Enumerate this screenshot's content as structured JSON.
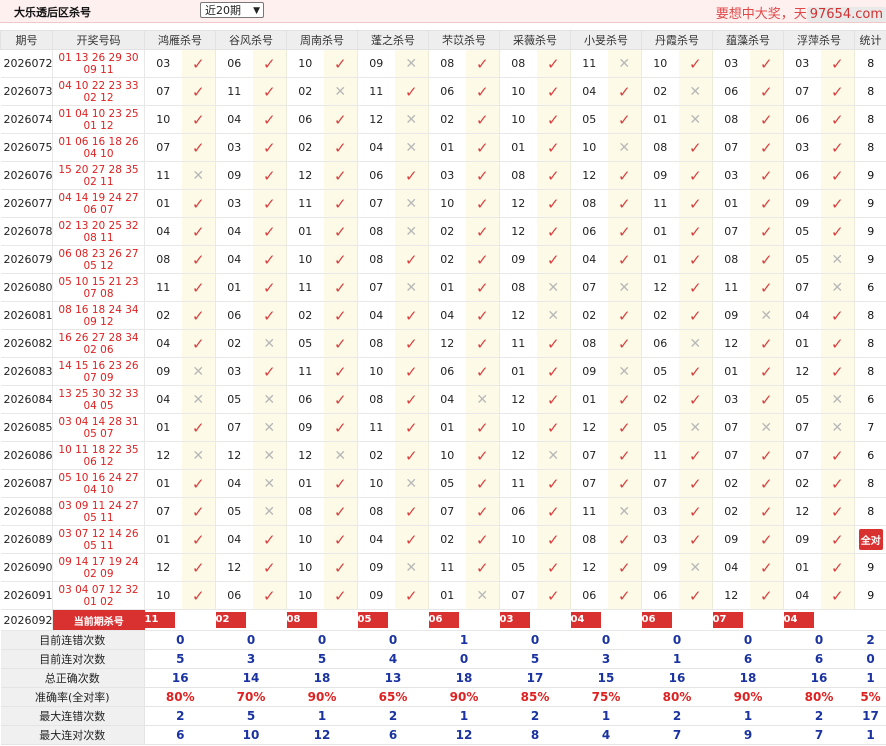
{
  "header": {
    "title": "大乐透后区杀号",
    "period_select": "近20期",
    "slogan": "要想中大奖，天",
    "site": "97654.com"
  },
  "columns": {
    "issue": "期号",
    "draw": "开奖号码",
    "experts": [
      "鸿雁杀号",
      "谷风杀号",
      "周南杀号",
      "蓬之杀号",
      "芣苡杀号",
      "采薇杀号",
      "小旻杀号",
      "丹霞杀号",
      "蕴藻杀号",
      "浮萍杀号"
    ],
    "stat": "统计"
  },
  "rows": [
    {
      "issue": "2026072",
      "front": "01 13 26 29 30",
      "back": "09 11",
      "picks": [
        "03",
        "06",
        "10",
        "09",
        "08",
        "08",
        "11",
        "10",
        "03",
        "03"
      ],
      "marks": [
        1,
        1,
        1,
        0,
        1,
        1,
        0,
        1,
        1,
        1
      ],
      "stat": "8"
    },
    {
      "issue": "2026073",
      "front": "04 10 22 23 33",
      "back": "02 12",
      "picks": [
        "07",
        "11",
        "02",
        "11",
        "06",
        "10",
        "04",
        "02",
        "06",
        "07"
      ],
      "marks": [
        1,
        1,
        0,
        1,
        1,
        1,
        1,
        0,
        1,
        1
      ],
      "stat": "8"
    },
    {
      "issue": "2026074",
      "front": "01 04 10 23 25",
      "back": "01 12",
      "picks": [
        "10",
        "04",
        "06",
        "12",
        "02",
        "10",
        "05",
        "01",
        "08",
        "06"
      ],
      "marks": [
        1,
        1,
        1,
        0,
        1,
        1,
        1,
        0,
        1,
        1
      ],
      "stat": "8"
    },
    {
      "issue": "2026075",
      "front": "01 06 16 18 26",
      "back": "04 10",
      "picks": [
        "07",
        "03",
        "02",
        "04",
        "01",
        "01",
        "10",
        "08",
        "07",
        "03"
      ],
      "marks": [
        1,
        1,
        1,
        0,
        1,
        1,
        0,
        1,
        1,
        1
      ],
      "stat": "8"
    },
    {
      "issue": "2026076",
      "front": "15 20 27 28 35",
      "back": "02 11",
      "picks": [
        "11",
        "09",
        "12",
        "06",
        "03",
        "08",
        "12",
        "09",
        "03",
        "06"
      ],
      "marks": [
        0,
        1,
        1,
        1,
        1,
        1,
        1,
        1,
        1,
        1
      ],
      "stat": "9"
    },
    {
      "issue": "2026077",
      "front": "04 14 19 24 27",
      "back": "06 07",
      "picks": [
        "01",
        "03",
        "11",
        "07",
        "10",
        "12",
        "08",
        "11",
        "01",
        "09"
      ],
      "marks": [
        1,
        1,
        1,
        0,
        1,
        1,
        1,
        1,
        1,
        1
      ],
      "stat": "9"
    },
    {
      "issue": "2026078",
      "front": "02 13 20 25 32",
      "back": "08 11",
      "picks": [
        "04",
        "04",
        "01",
        "08",
        "02",
        "12",
        "06",
        "01",
        "07",
        "05"
      ],
      "marks": [
        1,
        1,
        1,
        0,
        1,
        1,
        1,
        1,
        1,
        1
      ],
      "stat": "9"
    },
    {
      "issue": "2026079",
      "front": "06 08 23 26 27",
      "back": "05 12",
      "picks": [
        "08",
        "04",
        "10",
        "08",
        "02",
        "09",
        "04",
        "01",
        "08",
        "05"
      ],
      "marks": [
        1,
        1,
        1,
        1,
        1,
        1,
        1,
        1,
        1,
        0
      ],
      "stat": "9"
    },
    {
      "issue": "2026080",
      "front": "05 10 15 21 23",
      "back": "07 08",
      "picks": [
        "11",
        "01",
        "11",
        "07",
        "01",
        "08",
        "07",
        "12",
        "11",
        "07"
      ],
      "marks": [
        1,
        1,
        1,
        0,
        1,
        0,
        0,
        1,
        1,
        0
      ],
      "stat": "6"
    },
    {
      "issue": "2026081",
      "front": "08 16 18 24 34",
      "back": "09 12",
      "picks": [
        "02",
        "06",
        "02",
        "04",
        "04",
        "12",
        "02",
        "02",
        "09",
        "04"
      ],
      "marks": [
        1,
        1,
        1,
        1,
        1,
        0,
        1,
        1,
        0,
        1
      ],
      "stat": "8"
    },
    {
      "issue": "2026082",
      "front": "16 26 27 28 34",
      "back": "02 06",
      "picks": [
        "04",
        "02",
        "05",
        "08",
        "12",
        "11",
        "08",
        "06",
        "12",
        "01"
      ],
      "marks": [
        1,
        0,
        1,
        1,
        1,
        1,
        1,
        0,
        1,
        1
      ],
      "stat": "8"
    },
    {
      "issue": "2026083",
      "front": "14 15 16 23 26",
      "back": "07 09",
      "picks": [
        "09",
        "03",
        "11",
        "10",
        "06",
        "01",
        "09",
        "05",
        "01",
        "12"
      ],
      "marks": [
        0,
        1,
        1,
        1,
        1,
        1,
        0,
        1,
        1,
        1
      ],
      "stat": "8"
    },
    {
      "issue": "2026084",
      "front": "13 25 30 32 33",
      "back": "04 05",
      "picks": [
        "04",
        "05",
        "06",
        "08",
        "04",
        "12",
        "01",
        "02",
        "03",
        "05"
      ],
      "marks": [
        0,
        0,
        1,
        1,
        0,
        1,
        1,
        1,
        1,
        0
      ],
      "stat": "6"
    },
    {
      "issue": "2026085",
      "front": "03 04 14 28 31",
      "back": "05 07",
      "picks": [
        "01",
        "07",
        "09",
        "11",
        "01",
        "10",
        "12",
        "05",
        "07",
        "07"
      ],
      "marks": [
        1,
        0,
        1,
        1,
        1,
        1,
        1,
        0,
        0,
        0
      ],
      "stat": "7"
    },
    {
      "issue": "2026086",
      "front": "10 11 18 22 35",
      "back": "06 12",
      "picks": [
        "12",
        "12",
        "12",
        "02",
        "10",
        "12",
        "07",
        "11",
        "07",
        "07"
      ],
      "marks": [
        0,
        0,
        0,
        1,
        1,
        0,
        1,
        1,
        1,
        1
      ],
      "stat": "6"
    },
    {
      "issue": "2026087",
      "front": "05 10 16 24 27",
      "back": "04 10",
      "picks": [
        "01",
        "04",
        "01",
        "10",
        "05",
        "11",
        "07",
        "07",
        "02",
        "02"
      ],
      "marks": [
        1,
        0,
        1,
        0,
        1,
        1,
        1,
        1,
        1,
        1
      ],
      "stat": "8"
    },
    {
      "issue": "2026088",
      "front": "03 09 11 24 27",
      "back": "05 11",
      "picks": [
        "07",
        "05",
        "08",
        "08",
        "07",
        "06",
        "11",
        "03",
        "02",
        "12"
      ],
      "marks": [
        1,
        0,
        1,
        1,
        1,
        1,
        0,
        1,
        1,
        1
      ],
      "stat": "8"
    },
    {
      "issue": "2026089",
      "front": "03 07 12 14 26",
      "back": "05 11",
      "picks": [
        "01",
        "04",
        "10",
        "04",
        "02",
        "10",
        "08",
        "03",
        "09",
        "09"
      ],
      "marks": [
        1,
        1,
        1,
        1,
        1,
        1,
        1,
        1,
        1,
        1
      ],
      "stat": "全对"
    },
    {
      "issue": "2026090",
      "front": "09 14 17 19 24",
      "back": "02 09",
      "picks": [
        "12",
        "12",
        "10",
        "09",
        "11",
        "05",
        "12",
        "09",
        "04",
        "01"
      ],
      "marks": [
        1,
        1,
        1,
        0,
        1,
        1,
        1,
        0,
        1,
        1
      ],
      "stat": "9"
    },
    {
      "issue": "2026091",
      "front": "03 04 07 12 32",
      "back": "01 02",
      "picks": [
        "10",
        "06",
        "10",
        "09",
        "01",
        "07",
        "06",
        "06",
        "12",
        "04"
      ],
      "marks": [
        1,
        1,
        1,
        1,
        0,
        1,
        1,
        1,
        1,
        1
      ],
      "stat": "9"
    }
  ],
  "current": {
    "issue": "2026092",
    "label": "当前期杀号",
    "picks": [
      "11",
      "02",
      "08",
      "05",
      "06",
      "03",
      "04",
      "06",
      "07",
      "04"
    ]
  },
  "summary": [
    {
      "label": "目前连错次数",
      "values": [
        "0",
        "0",
        "0",
        "0",
        "1",
        "0",
        "0",
        "0",
        "0",
        "0"
      ],
      "stat": "2",
      "red": false
    },
    {
      "label": "目前连对次数",
      "values": [
        "5",
        "3",
        "5",
        "4",
        "0",
        "5",
        "3",
        "1",
        "6",
        "6"
      ],
      "stat": "0",
      "red": false
    },
    {
      "label": "总正确次数",
      "values": [
        "16",
        "14",
        "18",
        "13",
        "18",
        "17",
        "15",
        "16",
        "18",
        "16"
      ],
      "stat": "1",
      "red": false
    },
    {
      "label": "准确率(全对率)",
      "values": [
        "80%",
        "70%",
        "90%",
        "65%",
        "90%",
        "85%",
        "75%",
        "80%",
        "90%",
        "80%"
      ],
      "stat": "5%",
      "red": true
    },
    {
      "label": "最大连错次数",
      "values": [
        "2",
        "5",
        "1",
        "2",
        "1",
        "2",
        "1",
        "2",
        "1",
        "2"
      ],
      "stat": "17",
      "red": false
    },
    {
      "label": "最大连对次数",
      "values": [
        "6",
        "10",
        "12",
        "6",
        "12",
        "8",
        "4",
        "7",
        "9",
        "7"
      ],
      "stat": "1",
      "red": false
    }
  ],
  "icons": {
    "correct": "check-icon",
    "wrong": "cross-icon"
  },
  "colors": {
    "accent": "#d93030",
    "mark_bg": "#fdfbe8",
    "summary_value": "#1a33a0"
  }
}
